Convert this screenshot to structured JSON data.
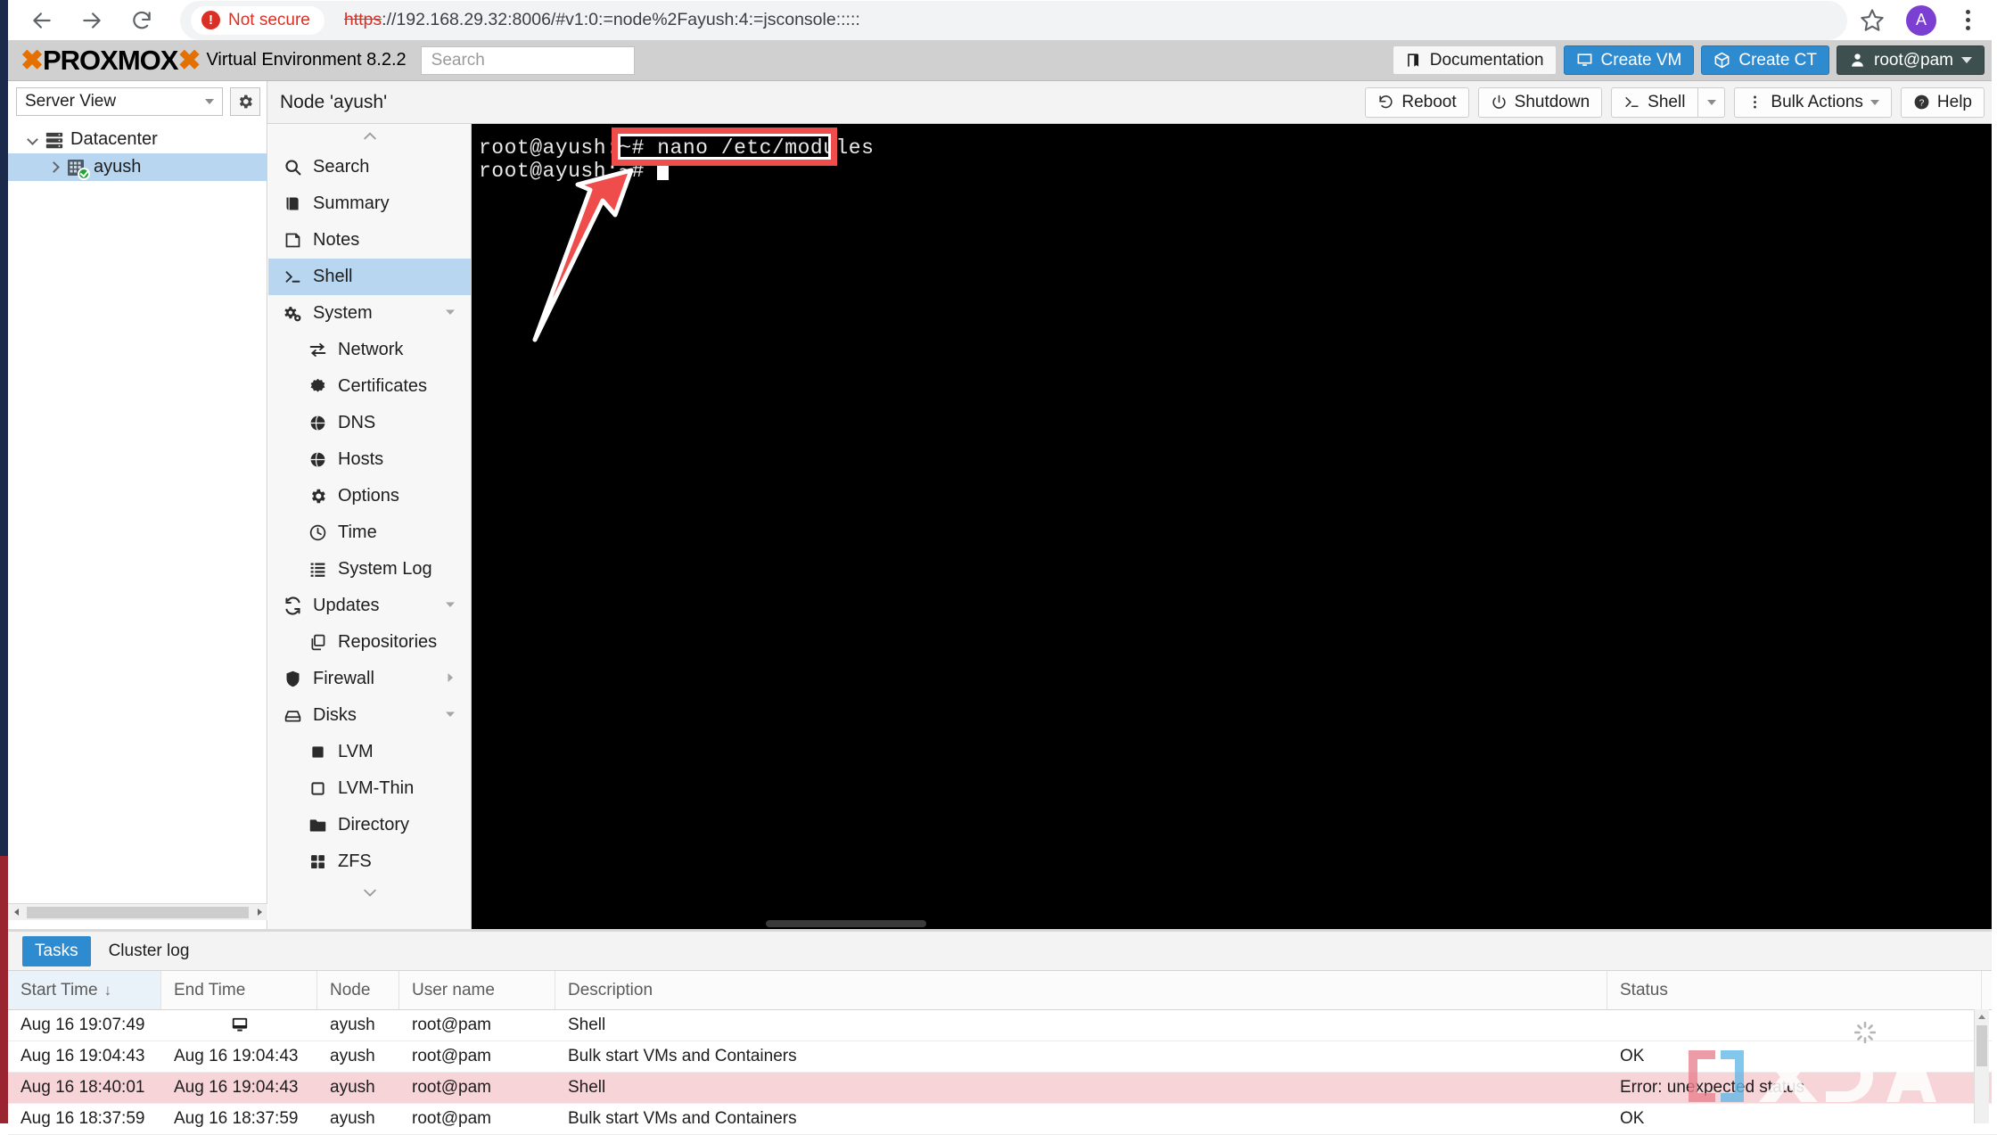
{
  "browser": {
    "back_icon": "back-arrow-icon",
    "forward_icon": "forward-arrow-icon",
    "reload_icon": "reload-icon",
    "security_label": "Not secure",
    "security_badge_glyph": "!",
    "url_scheme": "https",
    "url_rest": "://192.168.29.32:8006/#v1:0:=node%2Fayush:4:=jsconsole:::::",
    "bookmark_icon": "star-icon",
    "profile_initial": "A",
    "menu_icon": "three-dot-menu-icon"
  },
  "pve_header": {
    "logo_text": "PROXMOX",
    "product": "Virtual Environment 8.2.2",
    "search_placeholder": "Search",
    "buttons": [
      {
        "label": "Documentation",
        "icon": "book-icon",
        "style": "light"
      },
      {
        "label": "Create VM",
        "icon": "monitor-icon",
        "style": "blue"
      },
      {
        "label": "Create CT",
        "icon": "box-icon",
        "style": "blue"
      },
      {
        "label": "root@pam",
        "icon": "user-icon",
        "style": "dark"
      }
    ]
  },
  "node_bar": {
    "title": "Node 'ayush'",
    "buttons": [
      {
        "label": "Reboot",
        "icon": "reboot-icon"
      },
      {
        "label": "Shutdown",
        "icon": "power-icon"
      },
      {
        "label": "Shell",
        "icon": "terminal-icon",
        "has_split_caret": true
      },
      {
        "label": "Bulk Actions",
        "icon": "vertical-dots-icon",
        "has_caret": true
      },
      {
        "label": "Help",
        "icon": "help-icon"
      }
    ]
  },
  "server_view": {
    "selector_label": "Server View",
    "settings_icon": "gear-icon",
    "tree": [
      {
        "label": "Datacenter",
        "icon": "datacenter-icon",
        "expanded": true,
        "selected": false
      },
      {
        "label": "ayush",
        "icon": "node-icon",
        "expanded": false,
        "selected": true,
        "status": "online"
      }
    ]
  },
  "menu": {
    "scroll_up_icon": "chevron-up-icon",
    "scroll_down_icon": "chevron-down-icon",
    "items": [
      {
        "label": "Search",
        "icon": "search-icon",
        "indent": false,
        "selected": false
      },
      {
        "label": "Summary",
        "icon": "summary-icon",
        "indent": false,
        "selected": false
      },
      {
        "label": "Notes",
        "icon": "notes-icon",
        "indent": false,
        "selected": false
      },
      {
        "label": "Shell",
        "icon": "terminal-icon",
        "indent": false,
        "selected": true
      },
      {
        "label": "System",
        "icon": "system-gears-icon",
        "indent": false,
        "selected": false,
        "expander": "down"
      },
      {
        "label": "Network",
        "icon": "network-icon",
        "indent": true,
        "selected": false
      },
      {
        "label": "Certificates",
        "icon": "certificate-icon",
        "indent": true,
        "selected": false
      },
      {
        "label": "DNS",
        "icon": "globe-icon",
        "indent": true,
        "selected": false
      },
      {
        "label": "Hosts",
        "icon": "globe-icon",
        "indent": true,
        "selected": false
      },
      {
        "label": "Options",
        "icon": "gear-icon",
        "indent": true,
        "selected": false
      },
      {
        "label": "Time",
        "icon": "clock-icon",
        "indent": true,
        "selected": false
      },
      {
        "label": "System Log",
        "icon": "list-icon",
        "indent": true,
        "selected": false
      },
      {
        "label": "Updates",
        "icon": "refresh-icon",
        "indent": false,
        "selected": false,
        "expander": "down"
      },
      {
        "label": "Repositories",
        "icon": "copy-icon",
        "indent": true,
        "selected": false
      },
      {
        "label": "Firewall",
        "icon": "shield-icon",
        "indent": false,
        "selected": false,
        "expander": "right"
      },
      {
        "label": "Disks",
        "icon": "disk-icon",
        "indent": false,
        "selected": false,
        "expander": "down"
      },
      {
        "label": "LVM",
        "icon": "square-filled-icon",
        "indent": true,
        "selected": false
      },
      {
        "label": "LVM-Thin",
        "icon": "square-outline-icon",
        "indent": true,
        "selected": false
      },
      {
        "label": "Directory",
        "icon": "folder-icon",
        "indent": true,
        "selected": false
      },
      {
        "label": "ZFS",
        "icon": "grid-icon",
        "indent": true,
        "selected": false
      }
    ]
  },
  "terminal": {
    "prompt": "root@ayush:~#",
    "line1_command": "nano /etc/modules",
    "line2_command": "",
    "background": "#000000",
    "foreground": "#e8e8e8"
  },
  "annotation": {
    "highlight_color": "#ef4c4c",
    "highlight_target": "nano /etc/modules",
    "arrow_icon": "red-arrow-icon"
  },
  "bottom_panel": {
    "tabs": [
      {
        "label": "Tasks",
        "active": true
      },
      {
        "label": "Cluster log",
        "active": false
      }
    ],
    "columns": [
      "Start Time",
      "End Time",
      "Node",
      "User name",
      "Description",
      "Status"
    ],
    "sort_column": "Start Time",
    "sort_direction": "↓",
    "rows": [
      {
        "start": "Aug 16 19:07:49",
        "end": "",
        "end_icon": "monitor-icon",
        "node": "ayush",
        "user": "root@pam",
        "description": "Shell",
        "status": "",
        "error": false
      },
      {
        "start": "Aug 16 19:04:43",
        "end": "Aug 16 19:04:43",
        "end_icon": "",
        "node": "ayush",
        "user": "root@pam",
        "description": "Bulk start VMs and Containers",
        "status": "OK",
        "error": false
      },
      {
        "start": "Aug 16 18:40:01",
        "end": "Aug 16 19:04:43",
        "end_icon": "",
        "node": "ayush",
        "user": "root@pam",
        "description": "Shell",
        "status": "Error: unexpected status",
        "error": true
      },
      {
        "start": "Aug 16 18:37:59",
        "end": "Aug 16 18:37:59",
        "end_icon": "",
        "node": "ayush",
        "user": "root@pam",
        "description": "Bulk start VMs and Containers",
        "status": "OK",
        "error": false
      }
    ],
    "loading_icon": "spinner-icon"
  },
  "watermark": {
    "text": "XDA"
  }
}
